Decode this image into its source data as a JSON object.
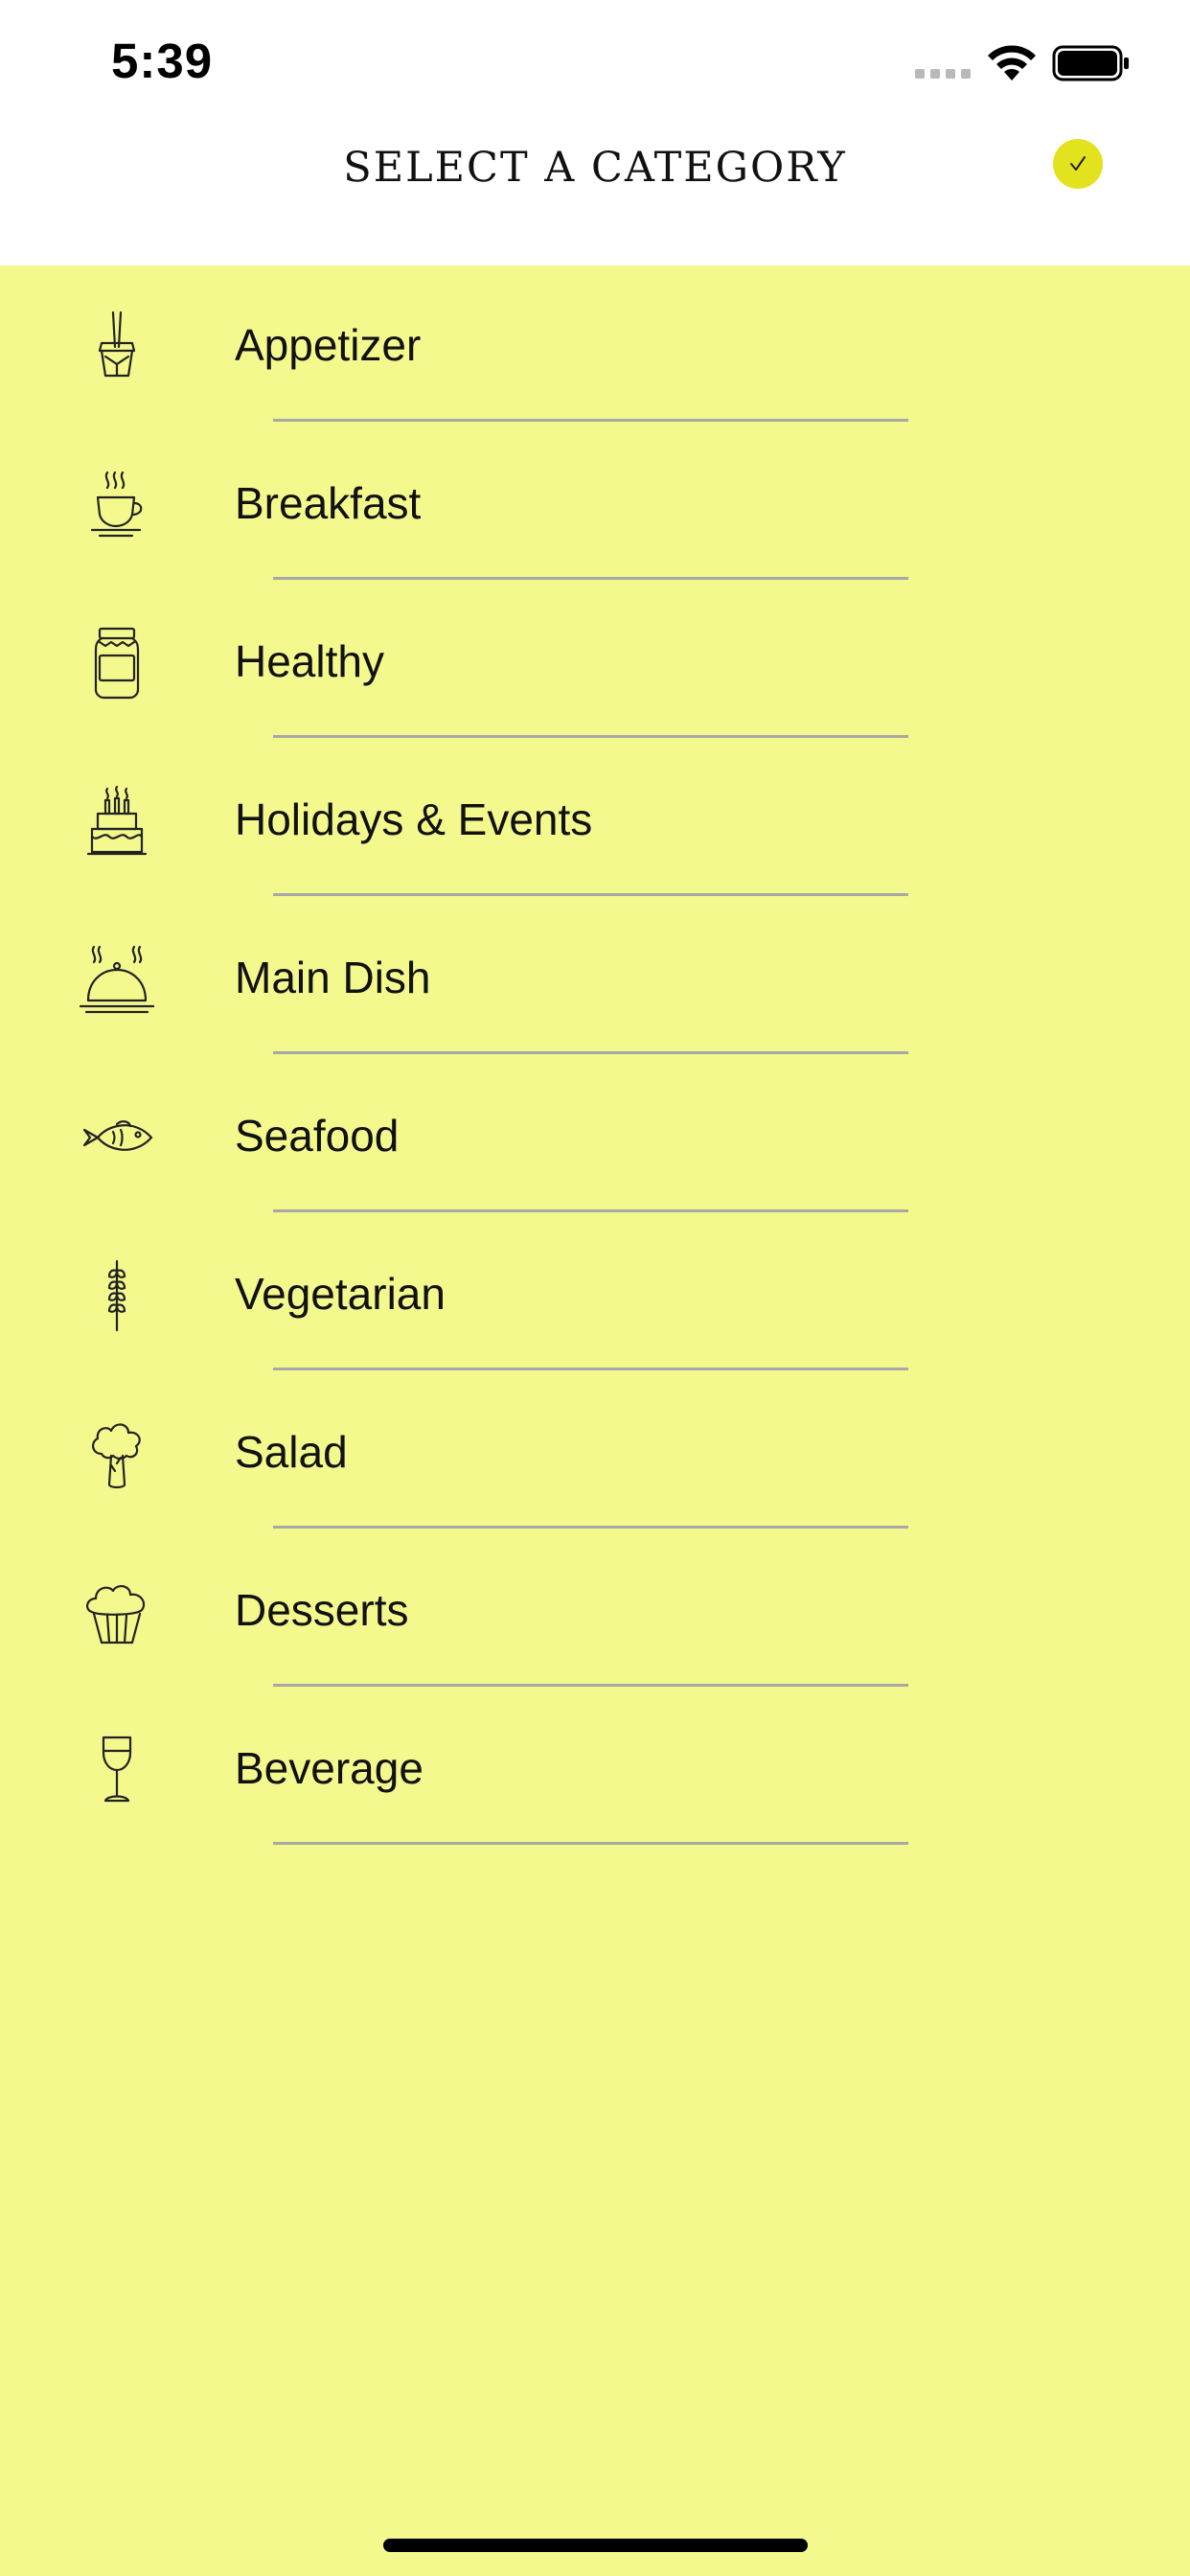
{
  "status_bar": {
    "time": "5:39"
  },
  "header": {
    "title": "SELECT A CATEGORY",
    "done_icon": "checkmark-icon",
    "accent_color": "#e2e21e"
  },
  "theme": {
    "background": "#f4f98d",
    "divider": "#a8a8a4"
  },
  "categories": [
    {
      "label": "Appetizer",
      "icon": "takeout-box-icon"
    },
    {
      "label": "Breakfast",
      "icon": "coffee-cup-icon"
    },
    {
      "label": "Healthy",
      "icon": "jar-icon"
    },
    {
      "label": "Holidays & Events",
      "icon": "cake-icon"
    },
    {
      "label": "Main Dish",
      "icon": "cloche-icon"
    },
    {
      "label": "Seafood",
      "icon": "fish-icon"
    },
    {
      "label": "Vegetarian",
      "icon": "wheat-icon"
    },
    {
      "label": "Salad",
      "icon": "broccoli-icon"
    },
    {
      "label": "Desserts",
      "icon": "cupcake-icon"
    },
    {
      "label": "Beverage",
      "icon": "wine-glass-icon"
    }
  ]
}
